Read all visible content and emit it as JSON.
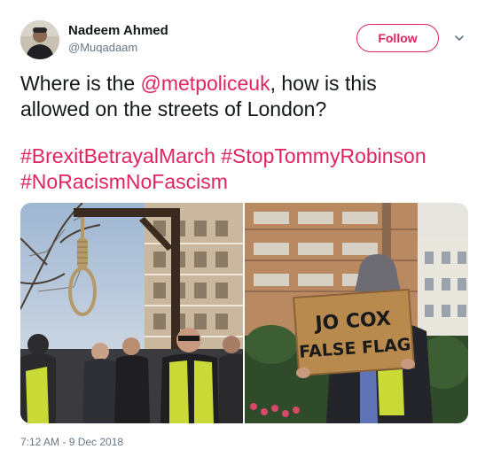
{
  "author": {
    "name": "Nadeem Ahmed",
    "handle": "@Muqadaam"
  },
  "follow_button": {
    "label": "Follow"
  },
  "tweet": {
    "text_before_mention": "Where is the ",
    "mention": "@metpoliceuk",
    "text_after_mention": ", how is this",
    "line2": "allowed on the streets of London?",
    "hashtags_line1": "#BrexitBetrayalMarch #StopTommyRobinson",
    "hashtags_line2": "#NoRacismNoFascism"
  },
  "media": {
    "right_photo_sign_line1": "JO COX",
    "right_photo_sign_line2": "FALSE FLAG"
  },
  "timestamp": "7:12 AM - 9 Dec 2018",
  "colors": {
    "accent": "#e0245e",
    "secondary_text": "#657786",
    "primary_text": "#14171a"
  },
  "icons": {
    "menu_caret": "chevron-down-icon"
  }
}
